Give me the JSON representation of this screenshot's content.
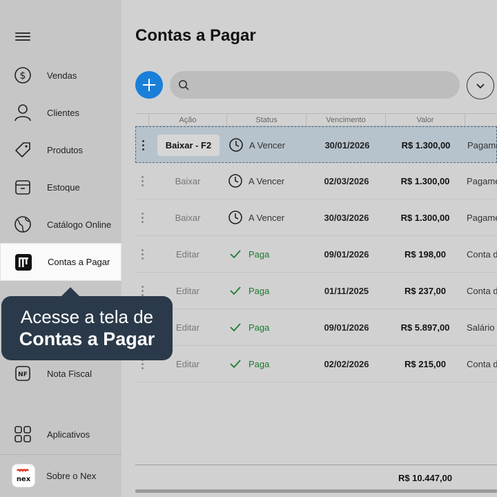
{
  "sidebar": {
    "items": [
      {
        "label": "Vendas",
        "icon": "dollar-icon"
      },
      {
        "label": "Clientes",
        "icon": "user-icon"
      },
      {
        "label": "Produtos",
        "icon": "tag-icon"
      },
      {
        "label": "Estoque",
        "icon": "box-icon"
      },
      {
        "label": "Catálogo Online",
        "icon": "globe-icon"
      },
      {
        "label": "Contas a Pagar",
        "icon": "bills-icon"
      },
      {
        "label": "Nota Fiscal",
        "icon": "nf-icon"
      },
      {
        "label": "Aplicativos",
        "icon": "apps-icon"
      },
      {
        "label": "Sobre o Nex",
        "icon": "nex-logo"
      }
    ],
    "nf_badge": "NF",
    "logo_text": "nex",
    "active": "Contas a Pagar"
  },
  "tooltip": {
    "line1": "Acesse a tela de",
    "line2": "Contas a Pagar"
  },
  "page": {
    "title": "Contas a Pagar"
  },
  "table": {
    "headers": [
      "Ação",
      "Status",
      "Vencimento",
      "Valor"
    ],
    "rows": [
      {
        "action": "Baixar - F2",
        "status": "A Vencer",
        "status_type": "pending",
        "due": "30/01/2026",
        "value": "R$ 1.300,00",
        "desc": "Pagame",
        "selected": true
      },
      {
        "action": "Baixar",
        "status": "A Vencer",
        "status_type": "pending",
        "due": "02/03/2026",
        "value": "R$ 1.300,00",
        "desc": "Pagame"
      },
      {
        "action": "Baixar",
        "status": "A Vencer",
        "status_type": "pending",
        "due": "30/03/2026",
        "value": "R$ 1.300,00",
        "desc": "Pagame"
      },
      {
        "action": "Editar",
        "status": "Paga",
        "status_type": "paid",
        "due": "09/01/2026",
        "value": "R$ 198,00",
        "desc": "Conta d"
      },
      {
        "action": "Editar",
        "status": "Paga",
        "status_type": "paid",
        "due": "01/11/2025",
        "value": "R$ 237,00",
        "desc": "Conta d"
      },
      {
        "action": "Editar",
        "status": "Paga",
        "status_type": "paid",
        "due": "09/01/2026",
        "value": "R$ 5.897,00",
        "desc": "Salário"
      },
      {
        "action": "Editar",
        "status": "Paga",
        "status_type": "paid",
        "due": "02/02/2026",
        "value": "R$ 215,00",
        "desc": "Conta d"
      }
    ],
    "total": "R$ 10.447,00"
  },
  "colors": {
    "accent": "#1a7fd9",
    "tooltip_bg": "#2b3a4a",
    "paid": "#1c7a2f"
  }
}
